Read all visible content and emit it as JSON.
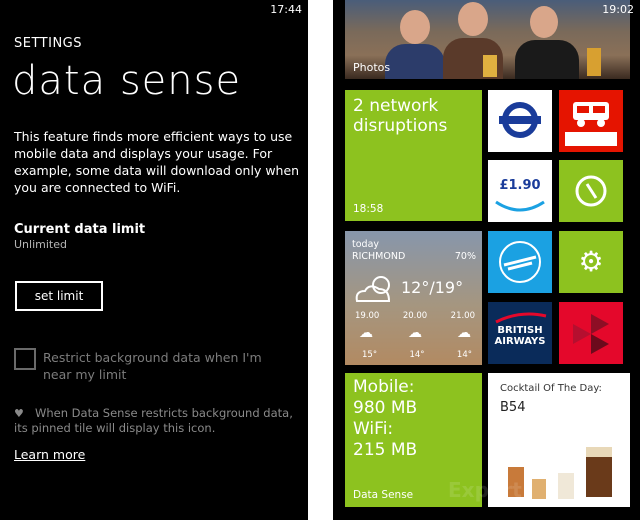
{
  "left_phone": {
    "clock": "17:44",
    "header": "SETTINGS",
    "title": "data sense",
    "description": "This feature finds more efficient ways to use mobile data and displays your usage. For example, some data will download only when you are connected to WiFi.",
    "limit_label": "Current data limit",
    "limit_value": "Unlimited",
    "set_limit_button": "set limit",
    "restrict_label": "Restrict background data when I'm near my limit",
    "note_line1": "When Data Sense restricts background data,",
    "note_line2": "its pinned tile will display this icon.",
    "learn_more": "Learn more"
  },
  "right_phone": {
    "clock": "19:02",
    "photos_label": "Photos",
    "disruptions": {
      "title_line1": "2 network",
      "title_line2": "disruptions",
      "time": "18:58"
    },
    "price_tile": "£1.90",
    "weather": {
      "day": "today",
      "city": "RICHMOND",
      "rain_chance": "70%",
      "temp": "12°/19°",
      "hours": [
        "19.00",
        "20.00",
        "21.00"
      ],
      "lows": [
        "15°",
        "14°",
        "14°"
      ]
    },
    "data_sense_tile": {
      "mobile_label": "Mobile:",
      "mobile_value": "980 MB",
      "wifi_label": "WiFi:",
      "wifi_value": "215 MB",
      "tile_name": "Data Sense"
    },
    "ba_tile": {
      "line1": "BRITISH",
      "line2": "AIRWAYS"
    },
    "cocktail": {
      "heading": "Cocktail Of The Day:",
      "name": "B54"
    },
    "watermark": "Expert"
  },
  "colors": {
    "green": "#8dc21f",
    "red": "#e51400",
    "blue": "#1ba1e2",
    "background": "#000000"
  }
}
